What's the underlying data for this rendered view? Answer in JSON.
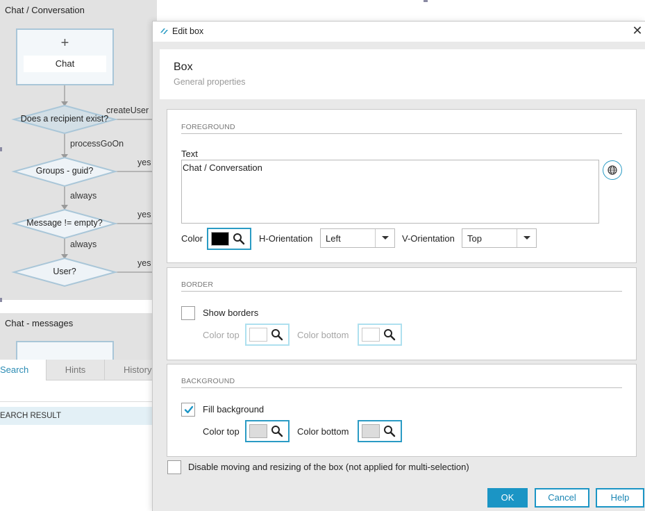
{
  "workflow": {
    "box1_title": "Chat / Conversation",
    "start_node": {
      "plus": "+",
      "label": "Chat"
    },
    "decisions": [
      {
        "label": "Does a recipient exist?"
      },
      {
        "label": "Groups - guid?"
      },
      {
        "label": "Message != empty?"
      },
      {
        "label": "User?"
      }
    ],
    "edge_labels": {
      "create_user": "createUser",
      "process_go_on": "processGoOn",
      "always_1": "always",
      "always_2": "always",
      "yes_1": "yes",
      "yes_2": "yes",
      "yes_3": "yes"
    },
    "box2_title": "Chat - messages"
  },
  "bottom_panel": {
    "tabs": [
      "Search",
      "Hints",
      "History"
    ],
    "result_header": "EARCH RESULT"
  },
  "dialog": {
    "title": "Edit box",
    "heading": "Box",
    "subheading": "General properties",
    "foreground": {
      "section_title": "FOREGROUND",
      "text_label": "Text",
      "text_value": "Chat / Conversation",
      "color_label": "Color",
      "color_value": "#000000",
      "h_orientation_label": "H-Orientation",
      "h_orientation_value": "Left",
      "v_orientation_label": "V-Orientation",
      "v_orientation_value": "Top"
    },
    "border": {
      "section_title": "BORDER",
      "show_borders_label": "Show borders",
      "show_borders_checked": false,
      "color_top_label": "Color top",
      "color_top_value": "#ffffff",
      "color_bottom_label": "Color bottom",
      "color_bottom_value": "#ffffff"
    },
    "background": {
      "section_title": "BACKGROUND",
      "fill_background_label": "Fill background",
      "fill_background_checked": true,
      "color_top_label": "Color top",
      "color_top_value": "#dcdcdc",
      "color_bottom_label": "Color bottom",
      "color_bottom_value": "#dcdcdc"
    },
    "disable_moving_label": "Disable moving and resizing of the box (not applied for multi-selection)",
    "disable_moving_checked": false,
    "buttons": {
      "ok": "OK",
      "cancel": "Cancel",
      "help": "Help"
    }
  },
  "colors": {
    "accent": "#1b95c5",
    "diamond_fill": "#eef3f7",
    "diamond_stroke": "#a9c6d8",
    "selected_diamond_fill": "#d3dfe6"
  },
  "icons": [
    "app-logo-icon",
    "close-icon",
    "plus-icon",
    "globe-icon",
    "magnifier-icon",
    "chevron-down-icon",
    "checkmark-icon"
  ]
}
